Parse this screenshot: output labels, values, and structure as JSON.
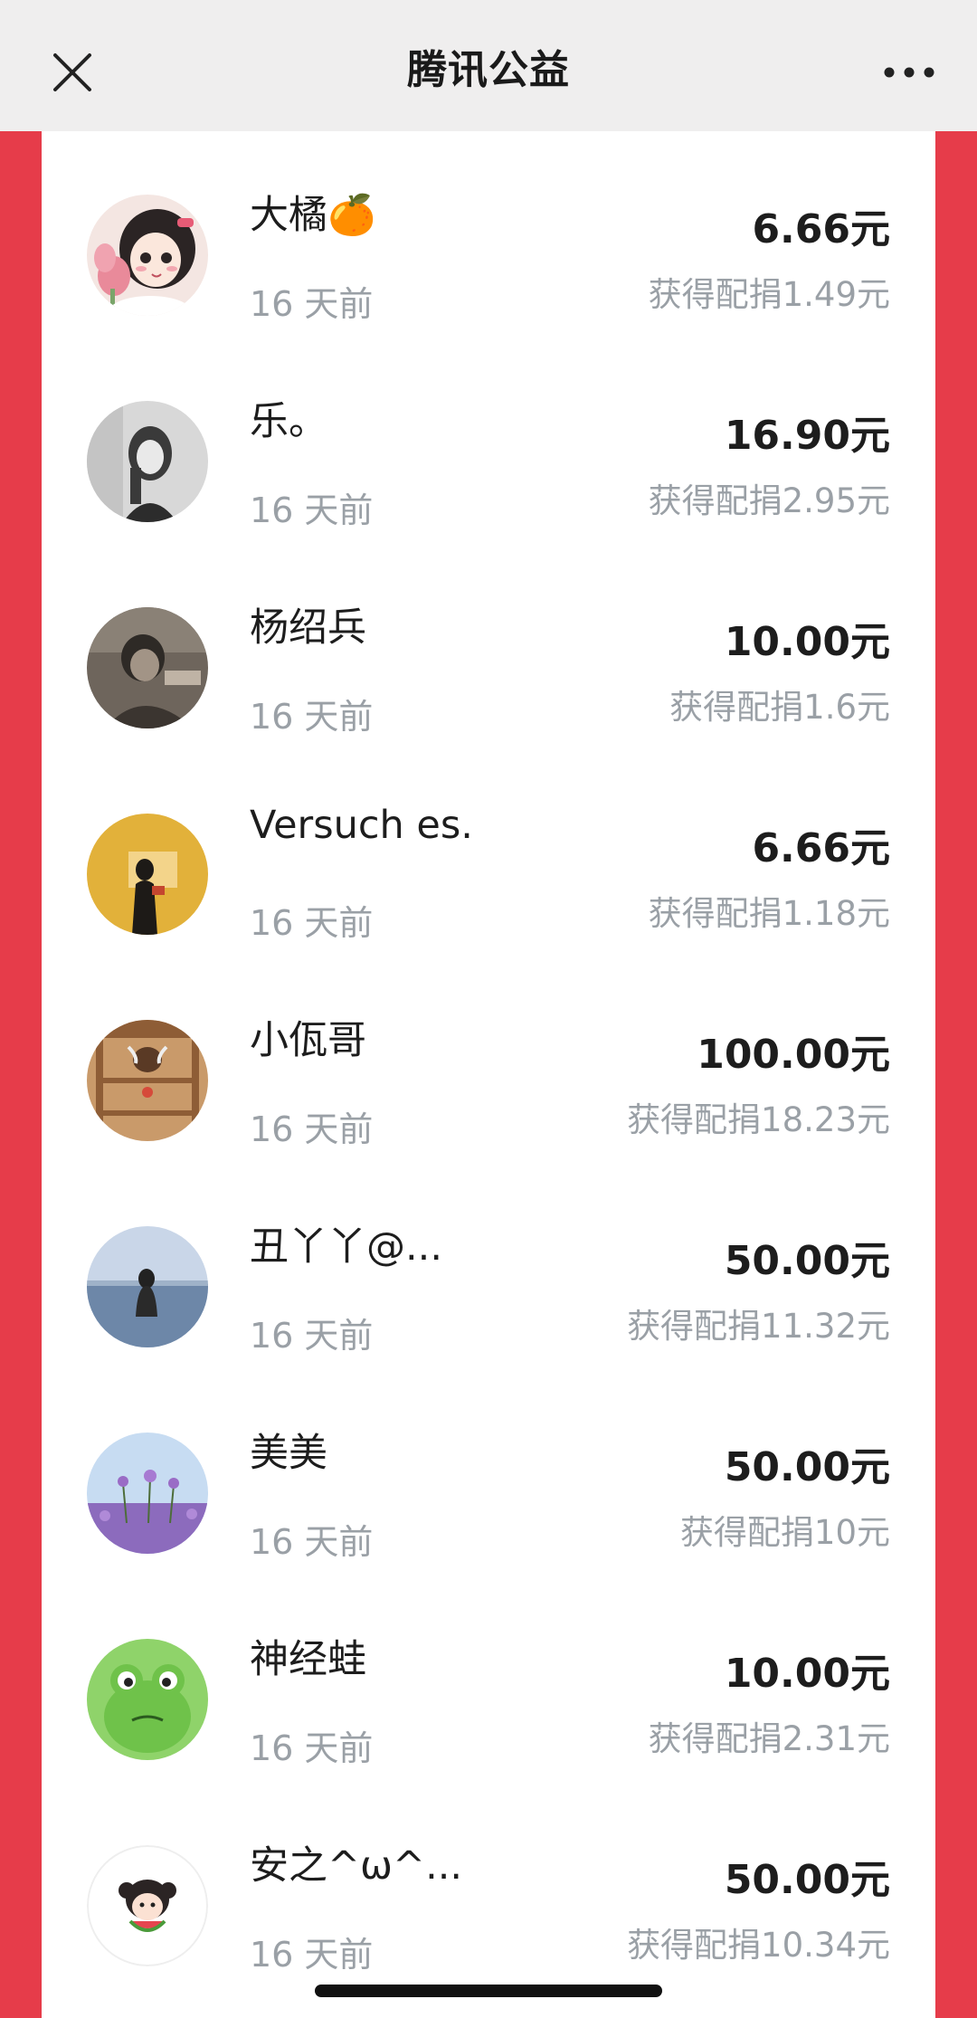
{
  "header": {
    "title": "腾讯公益",
    "close_icon": "close-icon",
    "more_icon": "more-icon"
  },
  "donations": [
    {
      "name": "大橘🍊",
      "time": "16 天前",
      "amount": "6.66元",
      "match": "获得配捐1.49元"
    },
    {
      "name": "乐。",
      "time": "16 天前",
      "amount": "16.90元",
      "match": "获得配捐2.95元"
    },
    {
      "name": "杨绍兵",
      "time": "16 天前",
      "amount": "10.00元",
      "match": "获得配捐1.6元"
    },
    {
      "name": "Versuch es.",
      "time": "16 天前",
      "amount": "6.66元",
      "match": "获得配捐1.18元"
    },
    {
      "name": "小佤哥",
      "time": "16 天前",
      "amount": "100.00元",
      "match": "获得配捐18.23元"
    },
    {
      "name": "丑丫丫@...",
      "time": "16 天前",
      "amount": "50.00元",
      "match": "获得配捐11.32元"
    },
    {
      "name": "美美",
      "time": "16 天前",
      "amount": "50.00元",
      "match": "获得配捐10元"
    },
    {
      "name": "神经蛙",
      "time": "16 天前",
      "amount": "10.00元",
      "match": "获得配捐2.31元"
    },
    {
      "name": "安之^ω^...",
      "time": "16 天前",
      "amount": "50.00元",
      "match": "获得配捐10.34元"
    }
  ],
  "colors": {
    "side_background": "#e63c4a",
    "header_background": "#efeeee",
    "secondary_text": "#9aa0a6"
  }
}
